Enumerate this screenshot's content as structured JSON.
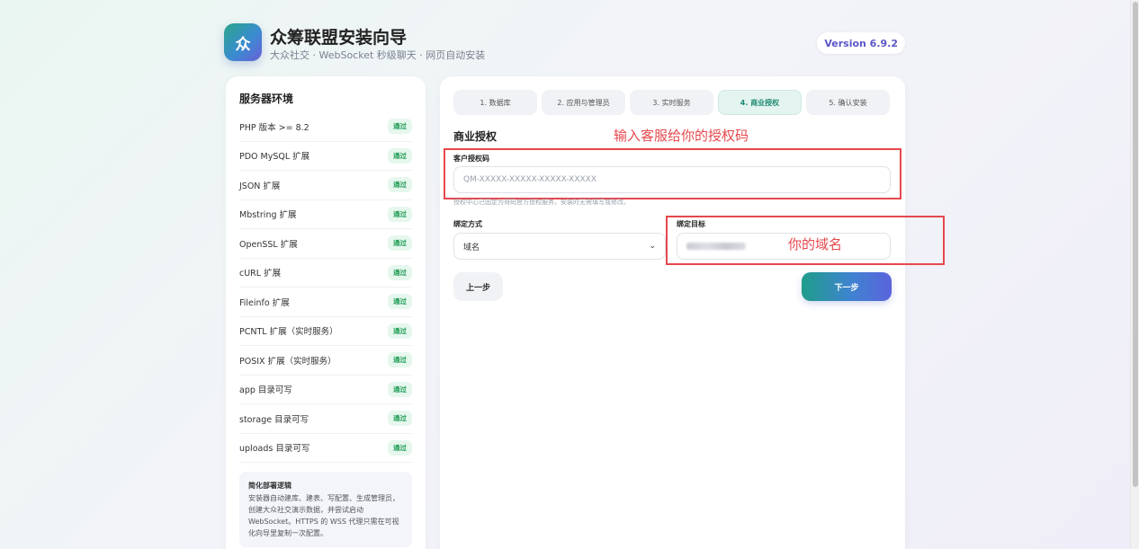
{
  "header": {
    "logo_text": "众",
    "title": "众筹联盟安装向导",
    "subtitle": "大众社交 · WebSocket 秒级聊天 · 网页自动安装",
    "version": "Version 6.9.2"
  },
  "environment": {
    "title": "服务器环境",
    "items": [
      {
        "label": "PHP 版本 >= 8.2",
        "status": "通过"
      },
      {
        "label": "PDO MySQL 扩展",
        "status": "通过"
      },
      {
        "label": "JSON 扩展",
        "status": "通过"
      },
      {
        "label": "Mbstring 扩展",
        "status": "通过"
      },
      {
        "label": "OpenSSL 扩展",
        "status": "通过"
      },
      {
        "label": "cURL 扩展",
        "status": "通过"
      },
      {
        "label": "Fileinfo 扩展",
        "status": "通过"
      },
      {
        "label": "PCNTL 扩展（实时服务）",
        "status": "通过"
      },
      {
        "label": "POSIX 扩展（实时服务）",
        "status": "通过"
      },
      {
        "label": "app 目录可写",
        "status": "通过"
      },
      {
        "label": "storage 目录可写",
        "status": "通过"
      },
      {
        "label": "uploads 目录可写",
        "status": "通过"
      }
    ],
    "note_title": "简化部署逻辑",
    "note_text": "安装器自动建库、建表、写配置、生成管理员，创建大众社交演示数据，并尝试启动 WebSocket。HTTPS 的 WSS 代理只需在可视化向导里复制一次配置。"
  },
  "steps": [
    {
      "label": "1. 数据库",
      "active": false
    },
    {
      "label": "2. 应用与管理员",
      "active": false
    },
    {
      "label": "3. 实时服务",
      "active": false
    },
    {
      "label": "4. 商业授权",
      "active": true
    },
    {
      "label": "5. 确认安装",
      "active": false
    }
  ],
  "license": {
    "section_title": "商业授权",
    "annotation_code": "输入客服给你的授权码",
    "code_label": "客户授权码",
    "code_placeholder": "QM-XXXXX-XXXXX-XXXXX-XXXXX",
    "hint": "授权中心已固定为哥码官方授权服务，安装时无需填写或修改。",
    "bind_method_label": "绑定方式",
    "bind_method_value": "域名",
    "bind_target_label": "绑定目标",
    "annotation_target": "你的域名"
  },
  "buttons": {
    "prev": "上一步",
    "next": "下一步"
  },
  "colors": {
    "accent_teal": "#1f9d8a",
    "accent_purple": "#5a63dc",
    "annotation_red": "#e5484d",
    "pass_green": "#1f9d55"
  }
}
